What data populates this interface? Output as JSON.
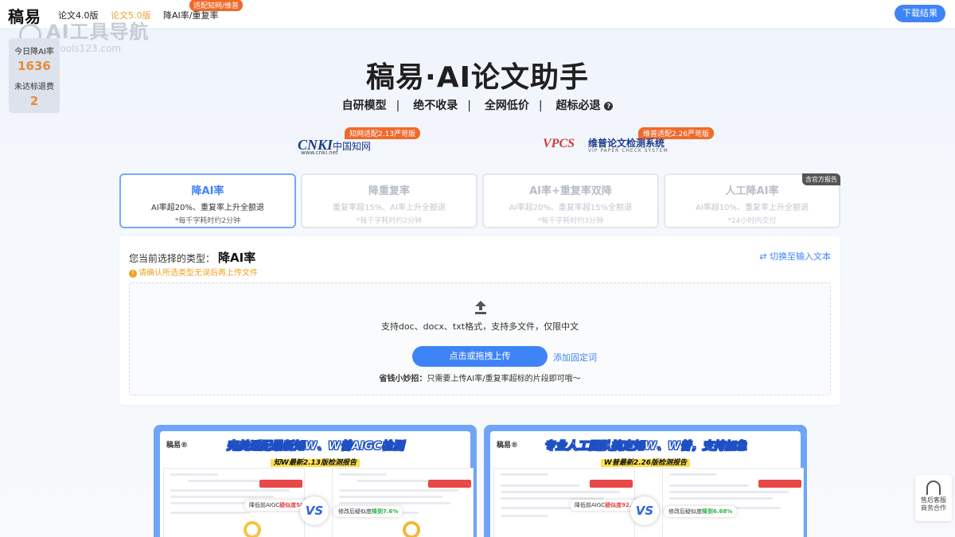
{
  "nav": {
    "logo": "稿易",
    "links": [
      "论文4.0版",
      "论文5.0版",
      "降AI率/重复率"
    ],
    "badge": "适配知网/维普",
    "download": "下载结果"
  },
  "watermark": {
    "main": "AI工具导航",
    "sub": "aitools123.com"
  },
  "stats": {
    "today_label": "今日降AI率",
    "today_value": "1636",
    "refund_label": "未达标退费",
    "refund_value": "2"
  },
  "hero": {
    "title": "稿易·AI论文助手",
    "features": [
      "自研模型",
      "绝不收录",
      "全网低价",
      "超标必退"
    ],
    "help_icon": "?"
  },
  "partners": {
    "cnki": {
      "tag": "知网适配2.13严苛版",
      "word": "CNKI",
      "cn": "中国知网",
      "url": "www.cnki.net"
    },
    "vpcs": {
      "tag": "维普适配2.26严苛版",
      "word": "VPCS",
      "cn": "维普论文检测系统",
      "en": "VIP PAPER CHECK SYSTEM"
    }
  },
  "modes": [
    {
      "title": "降AI率",
      "desc": "AI率超20%、重复率上升全额退",
      "time": "*每千字耗时约2分钟"
    },
    {
      "title": "降重复率",
      "desc": "重复率超15%、AI率上升全额退",
      "time": "*每千字耗时约2分钟"
    },
    {
      "title": "AI率+重复率双降",
      "desc": "AI率超20%、重复率超15%全额退",
      "time": "*每千字耗时约3分钟"
    },
    {
      "title": "人工降AI率",
      "desc": "AI率超10%、重复率上升全额退",
      "time": "*24小时内交付",
      "corner": "含官方报告"
    }
  ],
  "upload": {
    "selected_label": "您当前选择的类型：",
    "selected_type": "降AI率",
    "switch": "⇄ 切换至输入文本",
    "warning": "请确认所选类型无误后再上传文件",
    "formats": "支持doc、docx、txt格式，支持多文件，仅限中文",
    "button": "点击或拖拽上传",
    "add_words": "添加固定词",
    "tip_bold": "省钱小妙招：",
    "tip": "只需要上传AI率/重复率超标的片段即可哦～"
  },
  "reports": [
    {
      "logo": "稿易®",
      "headline": "完美适配最新知W、W普AIGC检测",
      "subhead": "知W最新2.13版检测报告",
      "before": "降低前AIGC",
      "before_value": "疑似度58.5%",
      "after": "修改后疑似度",
      "after_value": "降到7.6%",
      "vs": "VS"
    },
    {
      "logo": "稿易®",
      "headline": "专业人工团队搞定知W、W普，支持加急",
      "subhead": "W普最新2.26版检测报告",
      "before": "降低前AIGC",
      "before_value": "疑似度92.42%",
      "after": "修改后疑似度",
      "after_value": "降到6.68%",
      "vs": "VS"
    }
  ],
  "service": {
    "line1": "售后客服",
    "line2": "商务合作"
  },
  "colors": {
    "accent": "#3f84f7",
    "brand_orange": "#f06a2c",
    "warn": "#f0a020"
  }
}
